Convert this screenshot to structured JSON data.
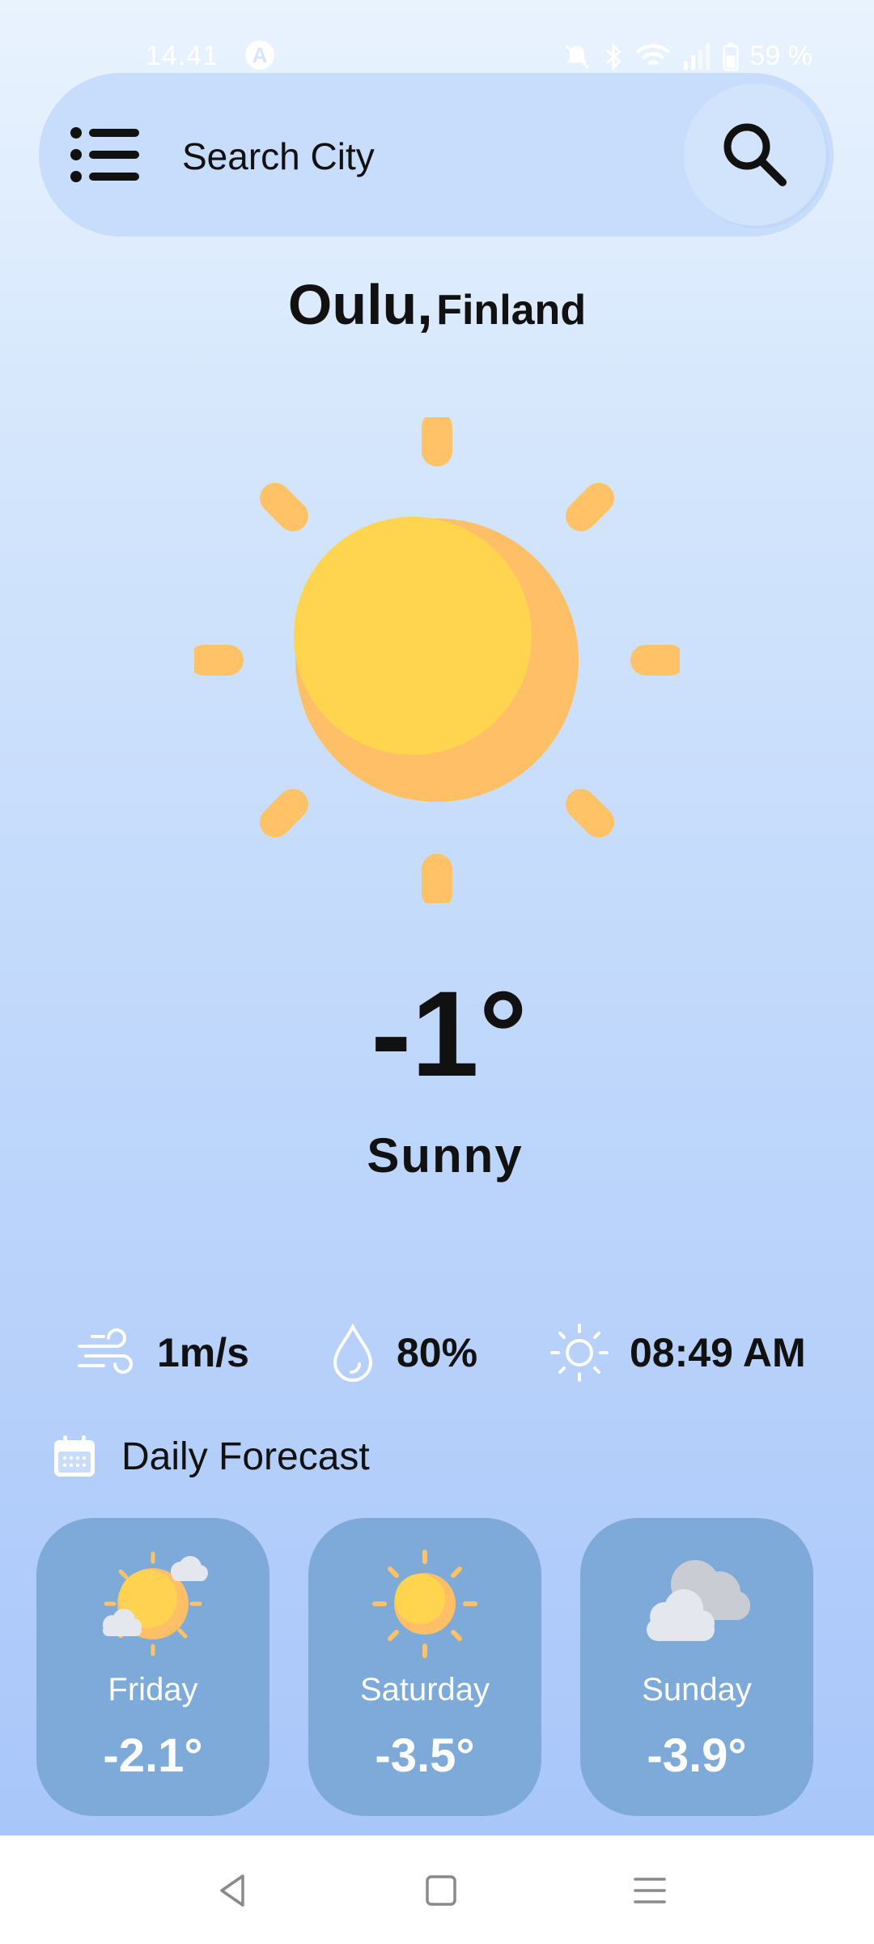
{
  "status": {
    "time": "14.41",
    "battery": "59 %"
  },
  "search": {
    "placeholder": "Search City"
  },
  "location": {
    "city": "Oulu,",
    "country": "Finland"
  },
  "current": {
    "temperature": "-1°",
    "condition": "Sunny",
    "icon": "sun-icon"
  },
  "stats": {
    "wind": "1m/s",
    "humidity": "80%",
    "sunrise": "08:49 AM"
  },
  "daily": {
    "label": "Daily Forecast",
    "days": [
      {
        "day": "Friday",
        "temp": "-2.1°",
        "icon": "partly-cloudy-icon"
      },
      {
        "day": "Saturday",
        "temp": "-3.5°",
        "icon": "sun-icon"
      },
      {
        "day": "Sunday",
        "temp": "-3.9°",
        "icon": "cloud-icon"
      }
    ]
  },
  "colors": {
    "sun_yellow": "#ffd54f",
    "sun_orange": "#ffbf66",
    "card_bg": "#7daad8",
    "search_bg": "#c8dcfb"
  }
}
